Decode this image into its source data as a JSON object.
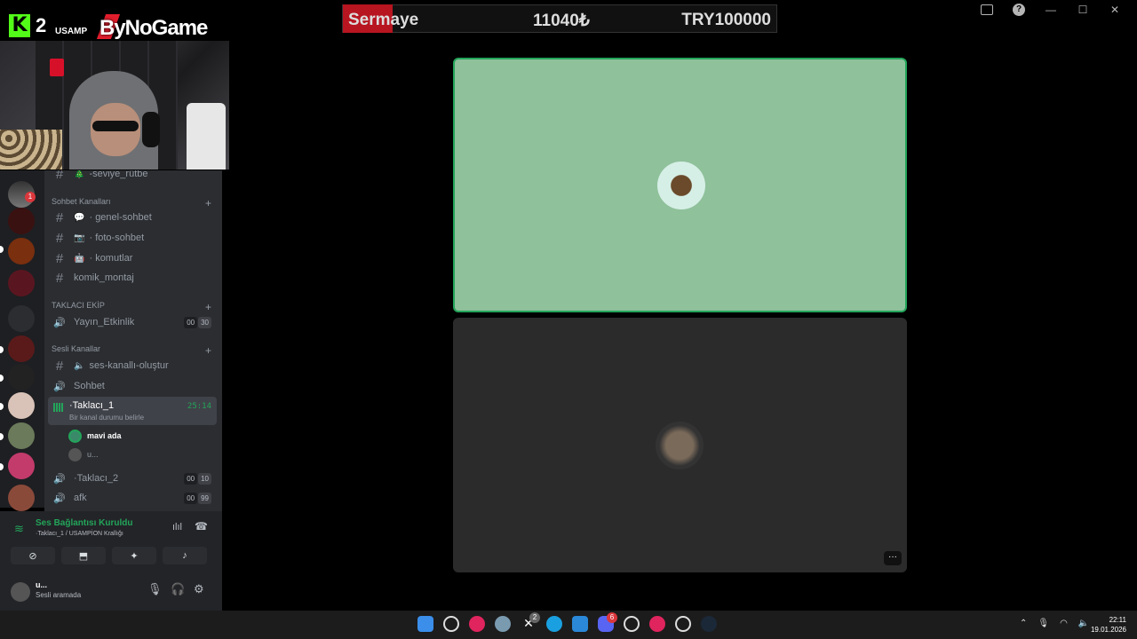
{
  "overlay": {
    "kick_count": "2",
    "channel_tag": "USAMP",
    "sponsor": "ByNoGame"
  },
  "capital_bar": {
    "label": "Sermaye",
    "current": "11040₺",
    "target": "TRY100000"
  },
  "window_controls": {
    "minimize": "—",
    "maximize": "☐",
    "close": "✕",
    "help": "?"
  },
  "server_rail": {
    "badge_count": "1"
  },
  "channels": {
    "top_channel": "-seviye_rütbe",
    "categories": {
      "chat": "Sohbet Kanalları",
      "taklaci": "TAKLACI EKİP",
      "voice": "Sesli Kanallar"
    },
    "text_channels": [
      {
        "name": "genel-sohbet",
        "prefix": "·"
      },
      {
        "name": "foto-sohbet",
        "prefix": "·"
      },
      {
        "name": "komutlar",
        "prefix": "·"
      },
      {
        "name": "komik_montaj",
        "prefix": ""
      }
    ],
    "yayin": {
      "name": "Yayın_Etkinlik",
      "chip_a": "00",
      "chip_b": "30"
    },
    "ses_olustur": "ses-kanallı-oluştur",
    "sohbet": "Sohbet",
    "active_voice": {
      "name": "·Taklacı_1",
      "status": "Bir kanal durumu belirle",
      "time": "25:14",
      "members": [
        {
          "name": "mavi ada"
        },
        {
          "name": "u..."
        }
      ]
    },
    "taklaci2": {
      "name": "·Taklacı_2",
      "chip_a": "00",
      "chip_b": "10"
    },
    "afk": {
      "name": "afk",
      "chip_a": "00",
      "chip_b": "99"
    }
  },
  "voice_panel": {
    "status": "Ses Bağlantısı Kuruldu",
    "location": "·Taklacı_1 / USAMPİON Krallığı"
  },
  "user_panel": {
    "name": "u...",
    "status": "Sesli aramada"
  },
  "stage": {
    "more_label": "···"
  },
  "taskbar": {
    "time": "22:11",
    "date": "19.01.2026",
    "x_badge": "2",
    "discord_badge": "6"
  },
  "colors": {
    "speaking_tile": "#8fc19b",
    "speaking_border": "#23a55a",
    "idle_tile": "#2b2b2b",
    "discord_sidebar": "#2b2d31",
    "capital_red": "#b71520"
  }
}
